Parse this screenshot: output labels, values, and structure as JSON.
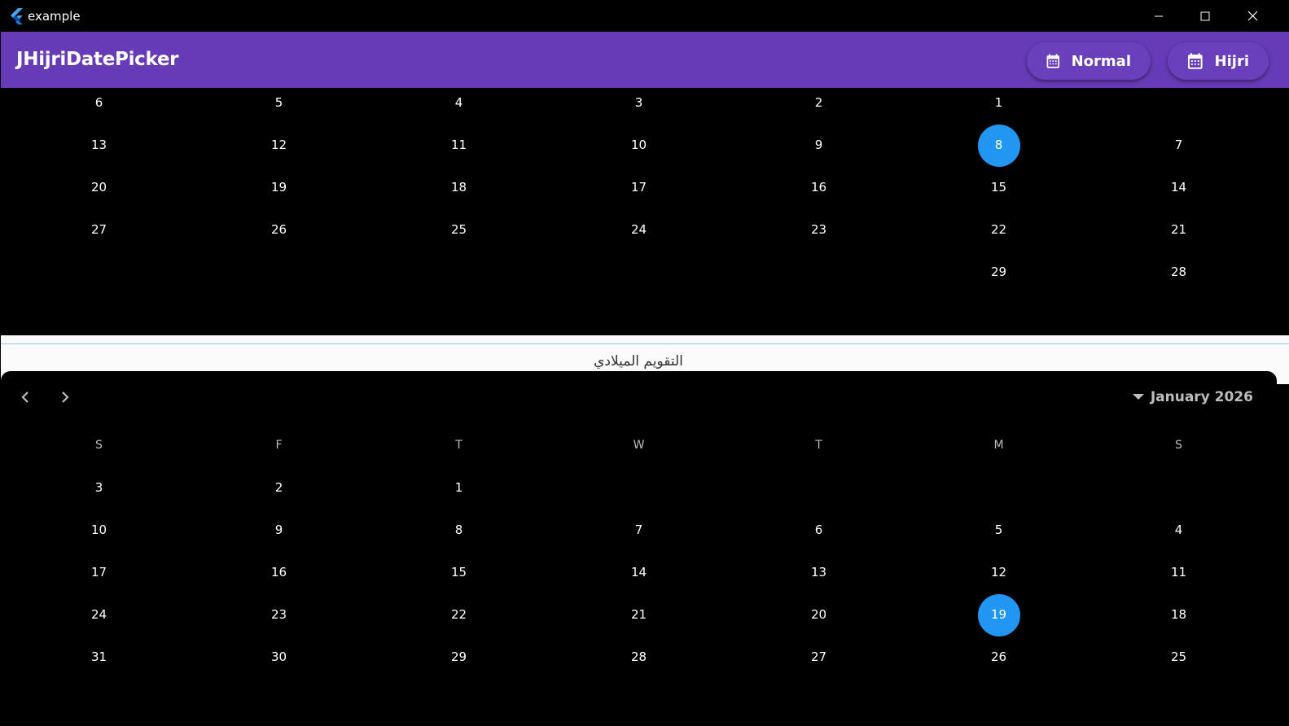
{
  "window": {
    "title": "example"
  },
  "appbar": {
    "title": "JHijriDatePicker",
    "buttons": [
      {
        "label": "Normal",
        "icon": "calendar-icon"
      },
      {
        "label": "Hijri",
        "icon": "calendar-icon"
      }
    ]
  },
  "colors": {
    "appbar": "#673ab7",
    "selected_day": "#2196f3",
    "background": "#000000"
  },
  "hijri_calendar": {
    "selected_day": "8",
    "weeks": [
      [
        "6",
        "5",
        "4",
        "3",
        "2",
        "1",
        ""
      ],
      [
        "13",
        "12",
        "11",
        "10",
        "9",
        "8",
        "7"
      ],
      [
        "20",
        "19",
        "18",
        "17",
        "16",
        "15",
        "14"
      ],
      [
        "27",
        "26",
        "25",
        "24",
        "23",
        "22",
        "21"
      ],
      [
        "",
        "",
        "",
        "",
        "",
        "29",
        "28"
      ]
    ]
  },
  "divider_label": "التقويم الميلادي",
  "gregorian_calendar": {
    "month_label": "January 2026",
    "selected_day": "19",
    "weekdays": [
      "S",
      "F",
      "T",
      "W",
      "T",
      "M",
      "S"
    ],
    "weeks": [
      [
        "3",
        "2",
        "1",
        "",
        "",
        "",
        ""
      ],
      [
        "10",
        "9",
        "8",
        "7",
        "6",
        "5",
        "4"
      ],
      [
        "17",
        "16",
        "15",
        "14",
        "13",
        "12",
        "11"
      ],
      [
        "24",
        "23",
        "22",
        "21",
        "20",
        "19",
        "18"
      ],
      [
        "31",
        "30",
        "29",
        "28",
        "27",
        "26",
        "25"
      ]
    ]
  }
}
